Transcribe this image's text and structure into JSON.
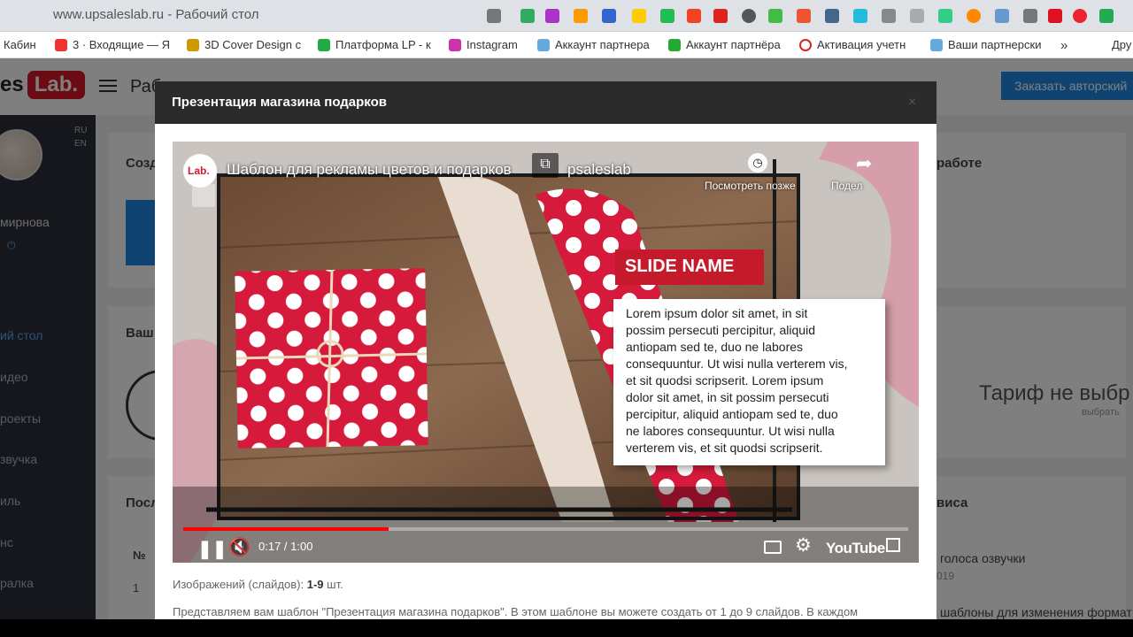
{
  "browser": {
    "url": "www.upsaleslab.ru - Рабочий стол",
    "bookmarks": [
      "Кабин",
      "3 · Входящие — Я",
      "3D Cover Design с",
      "Платформа LP - к",
      "Instagram",
      "Аккаунт партнера",
      "Аккаунт партнёра",
      "Активация учетн",
      "Ваши партнерски"
    ],
    "more": "»",
    "other": "Дру"
  },
  "app": {
    "logo_prefix": "es",
    "logo_badge": "Lab.",
    "page_title": "Раб",
    "order_button": "Заказать авторский",
    "user_name": "мирнова",
    "lang_ru": "RU",
    "lang_en": "EN",
    "nav": [
      "ий стол",
      "идео",
      "роекты",
      "звучка",
      "иль",
      "нс",
      "ралка"
    ],
    "card_titles": [
      "Созд",
      "Ваш",
      "Посл"
    ],
    "right_titles": [
      "работе",
      "виса"
    ],
    "tarif_title": "Тариф не выбр",
    "tarif_sub": "выбрать",
    "table_header": "№",
    "row_num": "1",
    "right_item": "голоса озвучки",
    "right_year": "019",
    "right_item2": "шаблоны для изменения формат"
  },
  "modal": {
    "title": "Презентация магазина подарков",
    "close": "×",
    "info_label": "Изображений (слайдов):",
    "info_value": "1-9",
    "info_unit": "шт.",
    "description": "Представляем вам шаблон \"Презентация магазина подарков\". В этом шаблоне вы можете создать от 1 до 9 слайдов. В каждом"
  },
  "video": {
    "channel_badge": "Lab.",
    "title": "Шаблон для рекламы цветов и подарков",
    "channel": "psaleslab",
    "watch_later": "Посмотреть позже",
    "share": "Подел",
    "slide_name": "SLIDE NAME",
    "lorem_lines": [
      "Lorem ipsum dolor sit amet, in sit",
      "possim persecuti percipitur, aliquid",
      "antiopam sed te, duo ne labores",
      "consequuntur. Ut wisi nulla verterem vis,",
      "et sit quodsi scripserit. Lorem ipsum",
      "dolor sit amet, in sit possim persecuti",
      "percipitur, aliquid antiopam sed te, duo",
      "ne labores consequuntur. Ut wisi nulla",
      "verterem vis, et sit quodsi scripserit."
    ],
    "time": "0:17 / 1:00",
    "progress": 0.2833,
    "youtube": "YouTube"
  },
  "colors": {
    "accent_red": "#d7192b",
    "brand_blue": "#1e88e5"
  }
}
